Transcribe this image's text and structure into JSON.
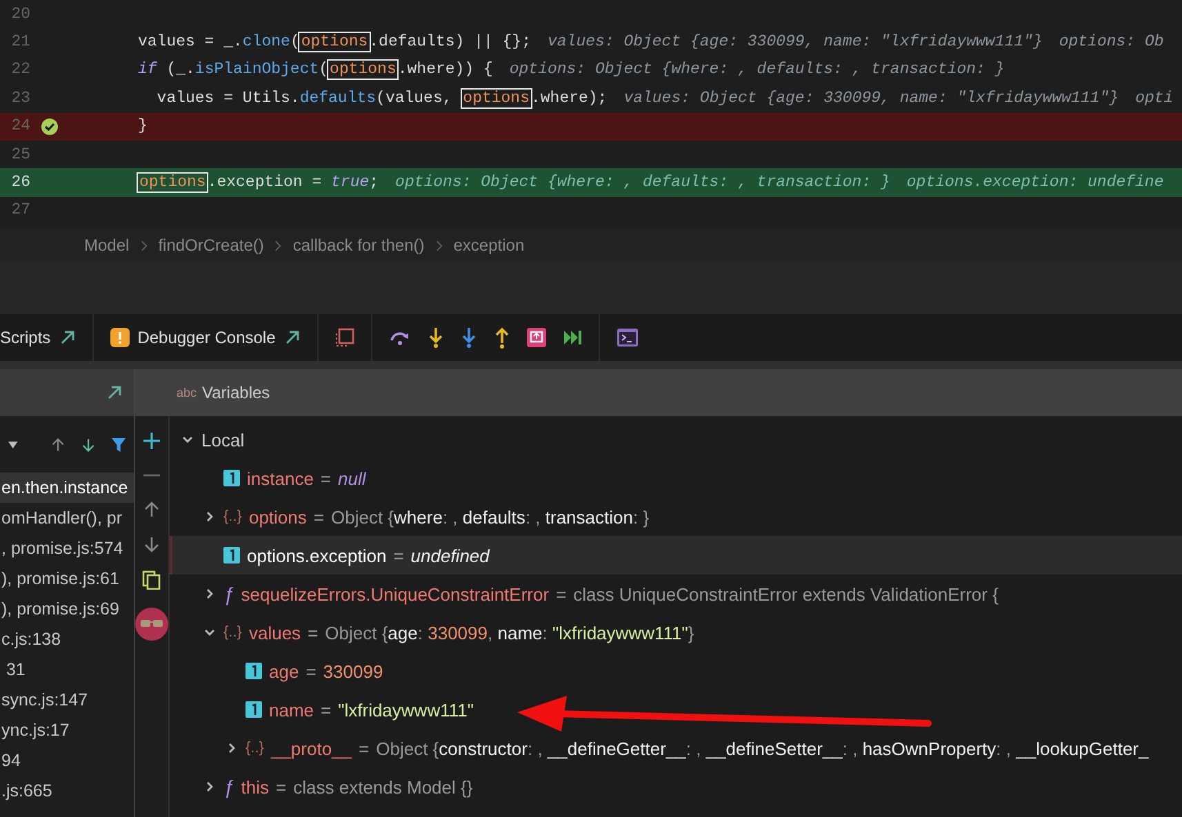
{
  "editor": {
    "lines": [
      {
        "number": "20",
        "kind": "normal"
      },
      {
        "number": "21",
        "kind": "normal",
        "tokens": [
          {
            "kind": "text",
            "text": "values = _."
          },
          {
            "kind": "fn",
            "text": "clone"
          },
          {
            "kind": "text",
            "text": "("
          },
          {
            "kind": "ref",
            "text": "options"
          },
          {
            "kind": "text",
            "text": ".defaults) || {};"
          },
          {
            "kind": "hint",
            "text": "values: Object {age: 330099, name: \"lxfridaywww111\"}"
          },
          {
            "kind": "hint",
            "text": "options: Ob"
          }
        ]
      },
      {
        "number": "22",
        "kind": "normal",
        "tokens": [
          {
            "kind": "kw",
            "text": "if"
          },
          {
            "kind": "text",
            "text": " (_."
          },
          {
            "kind": "fn",
            "text": "isPlainObject"
          },
          {
            "kind": "text",
            "text": "("
          },
          {
            "kind": "ref",
            "text": "options"
          },
          {
            "kind": "text",
            "text": ".where)) {"
          },
          {
            "kind": "hint",
            "text": "options: Object {where: , defaults: , transaction: }"
          }
        ]
      },
      {
        "number": "23",
        "kind": "normal",
        "tokens": [
          {
            "kind": "text",
            "text": "  values = Utils."
          },
          {
            "kind": "fn",
            "text": "defaults"
          },
          {
            "kind": "text",
            "text": "(values, "
          },
          {
            "kind": "ref",
            "text": "options"
          },
          {
            "kind": "text",
            "text": ".where);"
          },
          {
            "kind": "hint",
            "text": "values: Object {age: 330099, name: \"lxfridaywww111\"}"
          },
          {
            "kind": "hint",
            "text": "opti"
          }
        ]
      },
      {
        "number": "24",
        "kind": "breakpoint",
        "tokens": [
          {
            "kind": "text",
            "text": "}"
          }
        ]
      },
      {
        "number": "25",
        "kind": "normal"
      },
      {
        "number": "26",
        "kind": "current",
        "tokens": [
          {
            "kind": "ref",
            "text": "options"
          },
          {
            "kind": "text",
            "text": ".exception = "
          },
          {
            "kind": "kw",
            "text": "true"
          },
          {
            "kind": "text",
            "text": ";"
          },
          {
            "kind": "hint",
            "text": "options: Object {where: , defaults: , transaction: }"
          },
          {
            "kind": "hint",
            "text": "options.exception: undefine"
          }
        ]
      },
      {
        "number": "27",
        "kind": "normal"
      }
    ],
    "breadcrumbs": [
      "Model",
      "findOrCreate()",
      "callback for then()",
      "exception"
    ]
  },
  "toolbar": {
    "tabs": [
      {
        "label": "Scripts"
      },
      {
        "label": "Debugger Console"
      }
    ]
  },
  "frames": {
    "items": [
      {
        "label": "en.then.instance",
        "selected": true
      },
      {
        "label": "omHandler(), pr",
        "selected": false
      },
      {
        "label": ", promise.js:574",
        "selected": false
      },
      {
        "label": "), promise.js:61",
        "selected": false
      },
      {
        "label": "), promise.js:69",
        "selected": false
      },
      {
        "label": "c.js:138",
        "selected": false
      },
      {
        "label": " 31",
        "selected": false
      },
      {
        "label": "sync.js:147",
        "selected": false
      },
      {
        "label": "ync.js:17",
        "selected": false
      },
      {
        "label": "94",
        "selected": false
      },
      {
        "label": ".js:665",
        "selected": false
      }
    ]
  },
  "variables": {
    "header_badge": "abc",
    "title": "Variables",
    "tree": [
      {
        "kind": "scope",
        "name": "Local",
        "expanded": true,
        "selected": false,
        "children": [
          {
            "kind": "primitive",
            "name": "instance",
            "selected": false,
            "equals": "=",
            "value": [
              {
                "kind": "null",
                "text": "null"
              }
            ]
          },
          {
            "kind": "object",
            "glyph": "{..}",
            "name": "options",
            "expanded": false,
            "selected": false,
            "equals": "=",
            "value": [
              {
                "kind": "plain",
                "text": "Object {"
              },
              {
                "kind": "key",
                "text": "where"
              },
              {
                "kind": "plain",
                "text": ": , "
              },
              {
                "kind": "key",
                "text": "defaults"
              },
              {
                "kind": "plain",
                "text": ": , "
              },
              {
                "kind": "key",
                "text": "transaction"
              },
              {
                "kind": "plain",
                "text": ": }"
              }
            ]
          },
          {
            "kind": "primitive",
            "name": "options.exception",
            "selected": true,
            "equals": "=",
            "value": [
              {
                "kind": "undef",
                "text": "undefined"
              }
            ]
          },
          {
            "kind": "function",
            "glyph": "ƒ",
            "name": "sequelizeErrors.UniqueConstraintError",
            "expanded": false,
            "selected": false,
            "equals": "=",
            "value": [
              {
                "kind": "plain",
                "text": "class UniqueConstraintError extends ValidationError {"
              }
            ]
          },
          {
            "kind": "object",
            "glyph": "{..}",
            "name": "values",
            "expanded": true,
            "selected": false,
            "equals": "=",
            "value": [
              {
                "kind": "plain",
                "text": "Object {"
              },
              {
                "kind": "key",
                "text": "age"
              },
              {
                "kind": "plain",
                "text": ": "
              },
              {
                "kind": "num",
                "text": "330099"
              },
              {
                "kind": "plain",
                "text": ", "
              },
              {
                "kind": "key",
                "text": "name"
              },
              {
                "kind": "plain",
                "text": ": "
              },
              {
                "kind": "str",
                "text": "\"lxfridaywww111\""
              },
              {
                "kind": "plain",
                "text": "}"
              }
            ],
            "children": [
              {
                "kind": "primitive",
                "name": "age",
                "selected": false,
                "equals": "=",
                "value": [
                  {
                    "kind": "num",
                    "text": "330099"
                  }
                ]
              },
              {
                "kind": "primitive",
                "name": "name",
                "selected": false,
                "equals": "=",
                "value": [
                  {
                    "kind": "str",
                    "text": "\"lxfridaywww111\""
                  }
                ]
              },
              {
                "kind": "object",
                "glyph": "{..}",
                "name": "__proto__",
                "expanded": false,
                "selected": false,
                "equals": "=",
                "value": [
                  {
                    "kind": "plain",
                    "text": "Object {"
                  },
                  {
                    "kind": "key",
                    "text": "constructor"
                  },
                  {
                    "kind": "plain",
                    "text": ": , "
                  },
                  {
                    "kind": "key",
                    "text": "__defineGetter__"
                  },
                  {
                    "kind": "plain",
                    "text": ": , "
                  },
                  {
                    "kind": "key",
                    "text": "__defineSetter__"
                  },
                  {
                    "kind": "plain",
                    "text": ": , "
                  },
                  {
                    "kind": "key",
                    "text": "hasOwnProperty"
                  },
                  {
                    "kind": "plain",
                    "text": ": , "
                  },
                  {
                    "kind": "key",
                    "text": "__lookupGetter_"
                  }
                ]
              }
            ]
          },
          {
            "kind": "function",
            "glyph": "ƒ",
            "name": "this",
            "expanded": false,
            "selected": false,
            "equals": "=",
            "value": [
              {
                "kind": "plain",
                "text": "class extends Model {}"
              }
            ]
          }
        ]
      }
    ]
  }
}
